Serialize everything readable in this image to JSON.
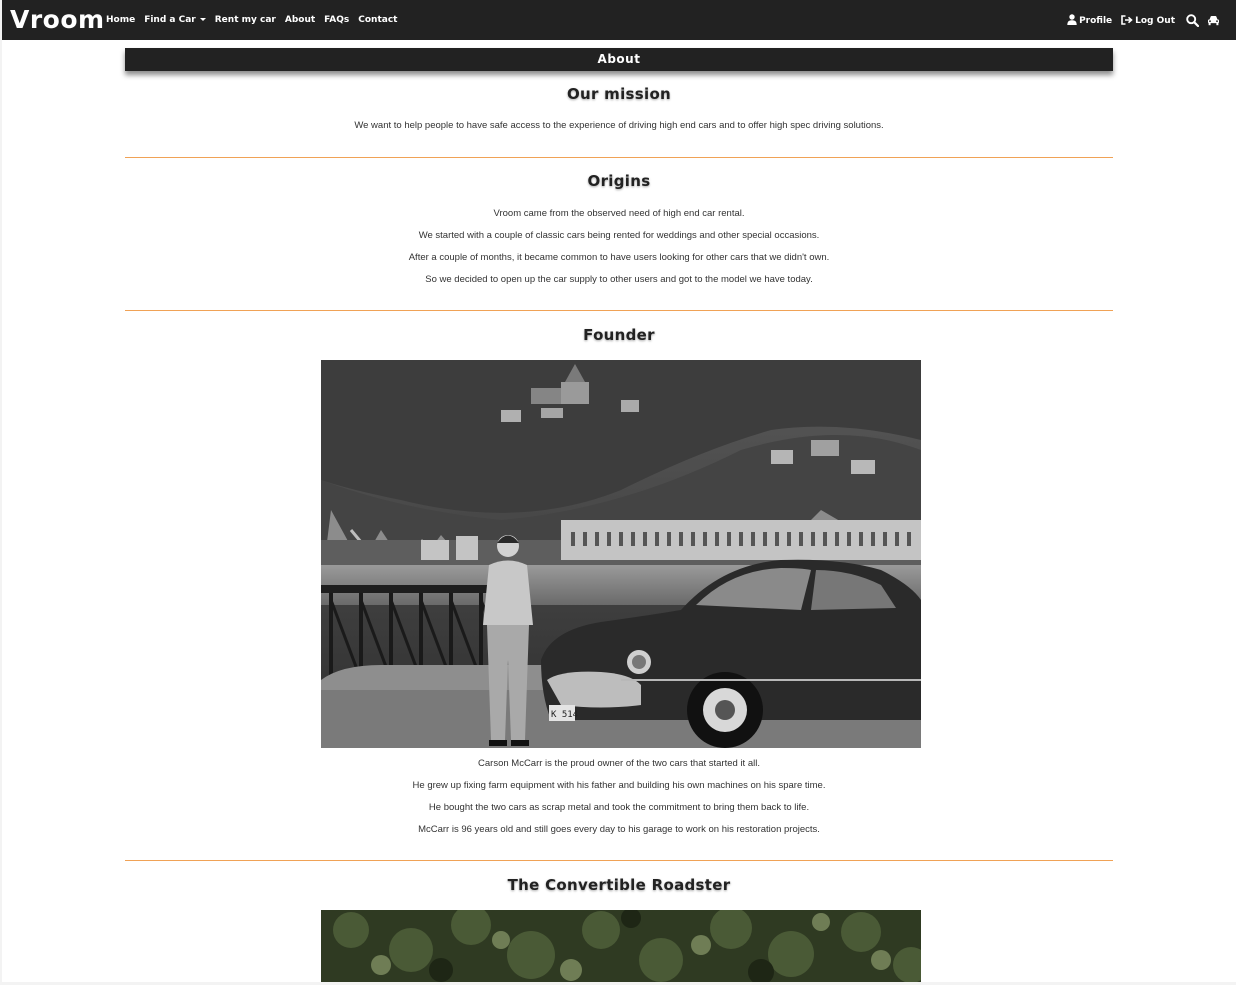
{
  "nav": {
    "brand": "Vroom",
    "links": [
      "Home",
      "Find a Car",
      "Rent my car",
      "About",
      "FAQs",
      "Contact"
    ],
    "profile": "Profile",
    "logout": "Log Out"
  },
  "page": {
    "header": "About"
  },
  "mission": {
    "title": "Our mission",
    "text": "We want to help people to have safe access to the experience of driving high end cars and to offer high spec driving solutions."
  },
  "origins": {
    "title": "Origins",
    "lines": [
      "Vroom came from the observed need of high end car rental.",
      "We started with a couple of classic cars being rented for weddings and other special occasions.",
      "After a couple of months, it became common to have users looking for other cars that we didn't own.",
      "So we decided to open up the car supply to other users and got to the model we have today."
    ]
  },
  "founder": {
    "title": "Founder",
    "photo_plate": "K 514",
    "lines": [
      "Carson McCarr is the proud owner of the two cars that started it all.",
      "He grew up fixing farm equipment with his father and building his own machines on his spare time.",
      "He bought the two cars as scrap metal and took the commitment to bring them back to life.",
      "McCarr is 96 years old and still goes every day to his garage to work on his restoration projects."
    ]
  },
  "roadster": {
    "title": "The Convertible Roadster"
  },
  "colors": {
    "navbar": "#222222",
    "divider": "#f0a256"
  }
}
